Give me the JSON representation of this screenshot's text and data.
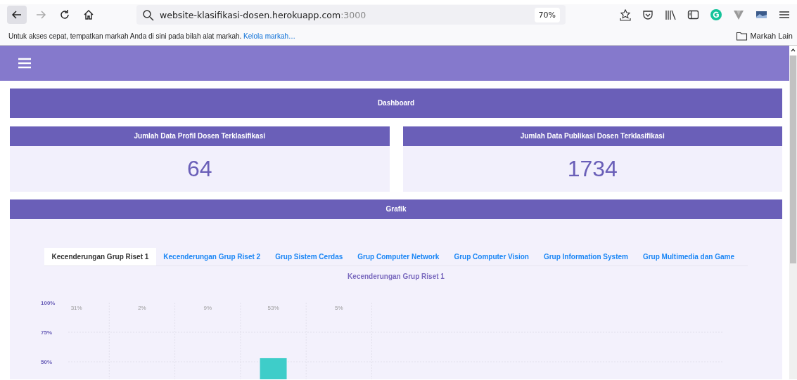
{
  "browser": {
    "nav_buttons": [
      {
        "kind": "back",
        "disabled": false
      },
      {
        "kind": "forward",
        "disabled": true
      },
      {
        "kind": "reload",
        "disabled": false
      },
      {
        "kind": "home",
        "disabled": false
      }
    ],
    "address": {
      "host": "website-klasifikasi-dosen.herokuapp.com",
      "port": ":3000"
    },
    "zoom": "70%",
    "bookmarks_bar": {
      "hint": "Untuk akses cepat, tempatkan markah Anda di sini pada bilah alat markah.",
      "link": "Kelola markah…",
      "folder": "Markah Lain"
    }
  },
  "dashboard": {
    "title": "Dashboard"
  },
  "stats": [
    {
      "title": "Jumlah Data Profil Dosen Terklasifikasi",
      "value": "64"
    },
    {
      "title": "Jumlah Data Publikasi Dosen Terklasifikasi",
      "value": "1734"
    }
  ],
  "grafik": {
    "title": "Grafik",
    "tabs": [
      {
        "label": "Kecenderungan Grup Riset 1",
        "selected": true
      },
      {
        "label": "Kecenderungan Grup Riset 2",
        "selected": false
      },
      {
        "label": "Grup Sistem Cerdas",
        "selected": false
      },
      {
        "label": "Grup Computer Network",
        "selected": false
      },
      {
        "label": "Grup Computer Vision",
        "selected": false
      },
      {
        "label": "Grup Information System",
        "selected": false
      },
      {
        "label": "Grup Multimedia dan Game",
        "selected": false
      }
    ],
    "chart_title": "Kecenderungan Grup Riset 1",
    "chart": {
      "y_labels": [
        "100%",
        "75%",
        "50%"
      ],
      "columns": [
        {
          "label": "31%"
        },
        {
          "label": "2%"
        },
        {
          "label": "9%"
        },
        {
          "label": "53%"
        },
        {
          "label": "5%"
        }
      ]
    }
  }
}
